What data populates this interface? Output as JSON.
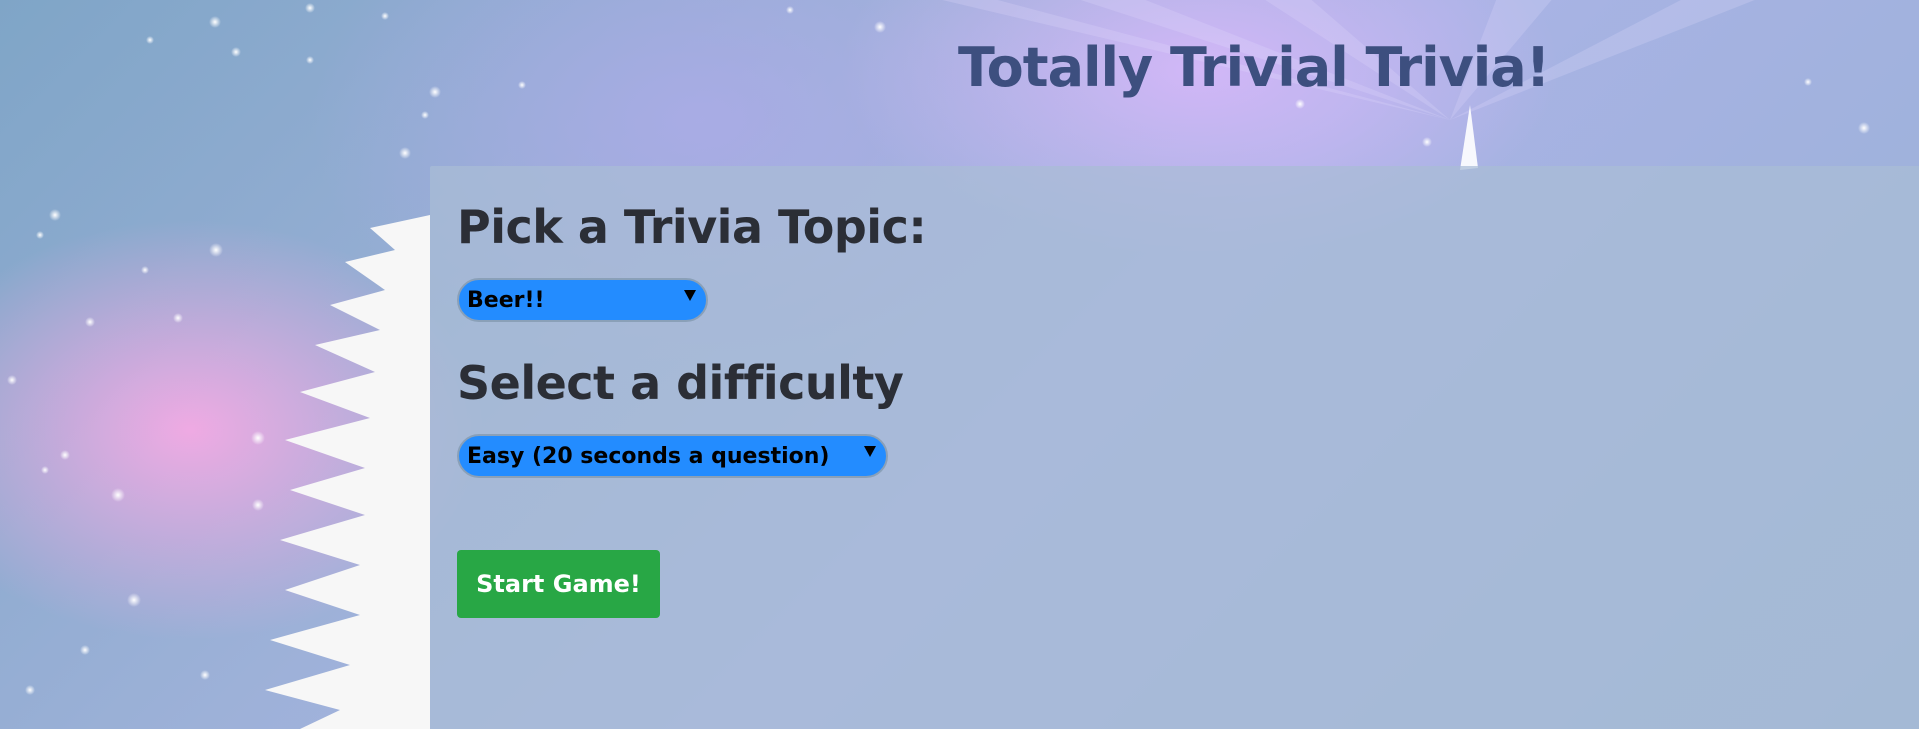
{
  "app": {
    "title": "Totally Trivial Trivia!"
  },
  "topic": {
    "heading": "Pick a Trivia Topic:",
    "selected": "Beer!!"
  },
  "difficulty": {
    "heading": "Select a difficulty",
    "selected": "Easy (20 seconds a question)"
  },
  "actions": {
    "start_label": "Start Game!"
  },
  "colors": {
    "title": "#3d4f7f",
    "select_bg": "#238cff",
    "start_button": "#28a745",
    "panel": "#a9bdd6",
    "heading": "#2b2e36"
  }
}
